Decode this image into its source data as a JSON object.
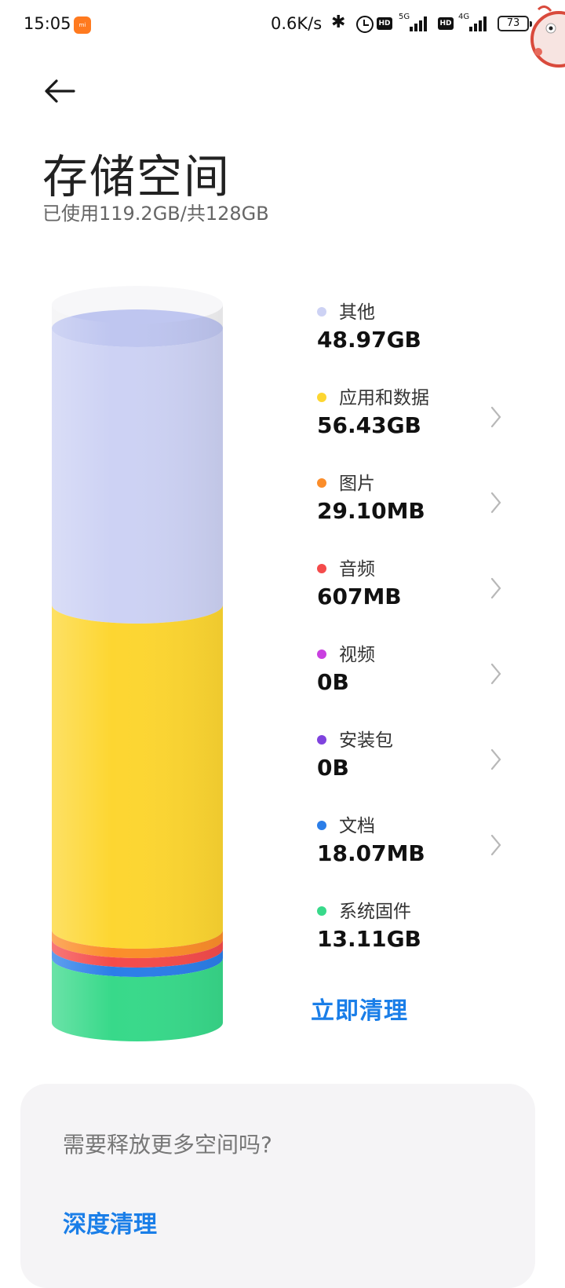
{
  "status_bar": {
    "time": "15:05",
    "app_badge": "mi",
    "net_speed": "0.6K/s",
    "hd1": "HD",
    "net1": "5G",
    "hd2": "HD",
    "net2": "4G",
    "battery": "73"
  },
  "header": {
    "title": "存储空间",
    "subtitle": "已使用119.2GB/共128GB"
  },
  "storage": {
    "items": [
      {
        "name": "其他",
        "size": "48.97GB",
        "color": "#cdd2f4",
        "has_chevron": false
      },
      {
        "name": "应用和数据",
        "size": "56.43GB",
        "color": "#fdd631",
        "has_chevron": true
      },
      {
        "name": "图片",
        "size": "29.10MB",
        "color": "#fb8d2a",
        "has_chevron": true
      },
      {
        "name": "音频",
        "size": "607MB",
        "color": "#f44b4b",
        "has_chevron": true
      },
      {
        "name": "视频",
        "size": "0B",
        "color": "#c940e0",
        "has_chevron": true
      },
      {
        "name": "安装包",
        "size": "0B",
        "color": "#7f43de",
        "has_chevron": true
      },
      {
        "name": "文档",
        "size": "18.07MB",
        "color": "#2b7ee8",
        "has_chevron": true
      },
      {
        "name": "系统固件",
        "size": "13.11GB",
        "color": "#38d98a",
        "has_chevron": false
      }
    ],
    "clean_now_label": "立即清理"
  },
  "card": {
    "title": "需要释放更多空间吗?",
    "deep_clean_label": "深度清理"
  },
  "colors": {
    "accent": "#1a7ee8",
    "free_space": "#f2f2f4"
  }
}
